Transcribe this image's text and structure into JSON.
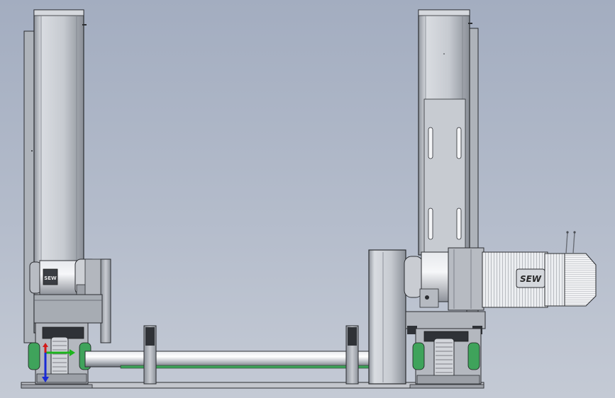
{
  "labels": {
    "left_motor_plate": "SEW",
    "right_motor_brand": "SEW"
  },
  "colors": {
    "background_top": "#a3adc0",
    "background_bottom": "#c4cad5",
    "steel_light": "#e6e8ec",
    "steel_mid": "#b9bdc5",
    "steel_dark": "#5a5e66",
    "outline": "#2b2d31",
    "guard_green": "#3fa35b",
    "triad_x": "#1db51d",
    "triad_y": "#d21b1b",
    "triad_z": "#1a2bd6"
  },
  "view": {
    "orientation_triad": {
      "axes": [
        "x",
        "y",
        "z"
      ]
    }
  }
}
